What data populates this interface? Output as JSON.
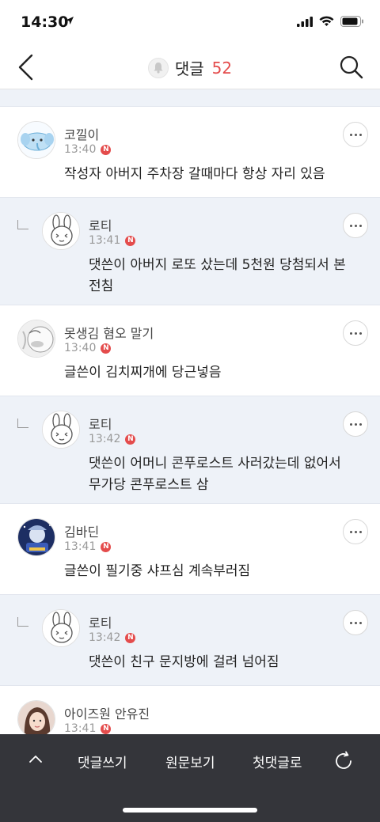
{
  "status": {
    "time": "14:30"
  },
  "header": {
    "title": "댓글",
    "count": "52"
  },
  "comments": [
    {
      "name": "코낄이",
      "time": "13:40",
      "badge": "N",
      "text": "작성자 아버지 주차장 갈때마다 항상 자리 있음",
      "reply": false,
      "avatar": "elephant"
    },
    {
      "name": "로티",
      "time": "13:41",
      "badge": "N",
      "text": "댓쓴이 아버지 로또 샀는데 5천원 당첨되서 본전침",
      "reply": true,
      "avatar": "bunny"
    },
    {
      "name": "못생김 혐오 말기",
      "time": "13:40",
      "badge": "N",
      "text": "글쓴이 김치찌개에 당근넣음",
      "reply": false,
      "avatar": "cartoon"
    },
    {
      "name": "로티",
      "time": "13:42",
      "badge": "N",
      "text": "댓쓴이 어머니 콘푸로스트 사러갔는데 없어서 무가당 콘푸로스트 삼",
      "reply": true,
      "avatar": "bunny"
    },
    {
      "name": "김바딘",
      "time": "13:41",
      "badge": "N",
      "text": "글쓴이 필기중 샤프심 계속부러짐",
      "reply": false,
      "avatar": "game"
    },
    {
      "name": "로티",
      "time": "13:42",
      "badge": "N",
      "text": "댓쓴이 친구 문지방에 걸려 넘어짐",
      "reply": true,
      "avatar": "bunny"
    },
    {
      "name": "아이즈원 안유진",
      "time": "13:41",
      "badge": "N",
      "text": "",
      "reply": false,
      "avatar": "photo"
    }
  ],
  "toolbar": {
    "write": "댓글쓰기",
    "original": "원문보기",
    "first": "첫댓글로"
  },
  "colors": {
    "accent": "#e44c4c",
    "reply_bg": "#eef2f8",
    "toolbar_bg": "#34353a"
  }
}
